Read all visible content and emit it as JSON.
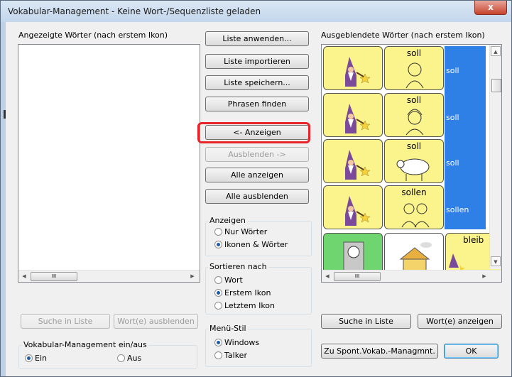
{
  "window": {
    "title": "Vokabular-Management - Keine Wort-/Sequenzliste geladen",
    "close_symbol": "x"
  },
  "left_panel": {
    "label": "Angezeigte Wörter (nach erstem Ikon)",
    "search_button": "Suche in Liste",
    "hide_words_button": "Wort(e) ausblenden"
  },
  "middle": {
    "apply_list": "Liste anwenden...",
    "import_list": "Liste importieren",
    "save_list": "Liste speichern...",
    "find_phrases": "Phrasen finden",
    "show": "<- Anzeigen",
    "hide": "Ausblenden ->",
    "show_all": "Alle anzeigen",
    "hide_all": "Alle ausblenden"
  },
  "anzeigen_group": {
    "label": "Anzeigen",
    "options": [
      "Nur Wörter",
      "Ikonen & Wörter"
    ],
    "selected": "Ikonen & Wörter"
  },
  "sort_group": {
    "label": "Sortieren nach",
    "options": [
      "Wort",
      "Erstem Ikon",
      "Letztem Ikon"
    ],
    "selected": "Erstem Ikon"
  },
  "menu_style_group": {
    "label": "Menü-Stil",
    "options": [
      "Windows",
      "Talker"
    ],
    "selected": "Windows"
  },
  "vocab_group": {
    "label": "Vokabular-Management ein/aus",
    "options": [
      "Ein",
      "Aus"
    ],
    "selected": "Ein"
  },
  "right_panel": {
    "label": "Ausgeblendete Wörter (nach erstem Ikon)",
    "rows": [
      {
        "icon_word": "soll",
        "word": "soll",
        "picture": "boy-icon"
      },
      {
        "icon_word": "soll",
        "word": "soll",
        "picture": "girl-icon"
      },
      {
        "icon_word": "soll",
        "word": "soll",
        "picture": "sheep-icon"
      },
      {
        "icon_word": "sollen",
        "word": "sollen",
        "picture": "people-icon"
      }
    ],
    "partial_row_text": "bleib",
    "search_button": "Suche in Liste",
    "show_words_button": "Wort(e) anzeigen"
  },
  "footer": {
    "spont_button": "Zu Spont.Vokab.-Managmnt.",
    "ok_button": "OK"
  },
  "scroll_thumb_grip": "III"
}
